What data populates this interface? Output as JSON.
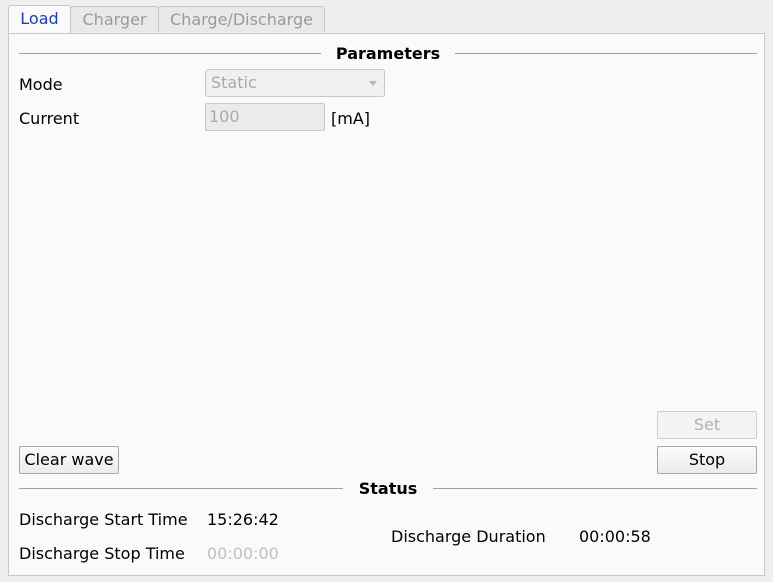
{
  "tabs": [
    {
      "label": "Load",
      "active": true
    },
    {
      "label": "Charger",
      "active": false
    },
    {
      "label": "Charge/Discharge",
      "active": false
    }
  ],
  "parameters": {
    "title": "Parameters",
    "mode_label": "Mode",
    "mode_value": "Static",
    "current_label": "Current",
    "current_value": "100",
    "current_unit": "[mA]"
  },
  "buttons": {
    "set": "Set",
    "stop": "Stop",
    "clear_wave": "Clear wave"
  },
  "status": {
    "title": "Status",
    "start_label": "Discharge Start Time",
    "start_value": "15:26:42",
    "stop_label": "Discharge Stop Time",
    "stop_value": "00:00:00",
    "duration_label": "Discharge Duration",
    "duration_value": "00:00:58"
  },
  "colors": {
    "active_tab_text": "#1c3fb0",
    "disabled_text": "#aaaaaa"
  }
}
